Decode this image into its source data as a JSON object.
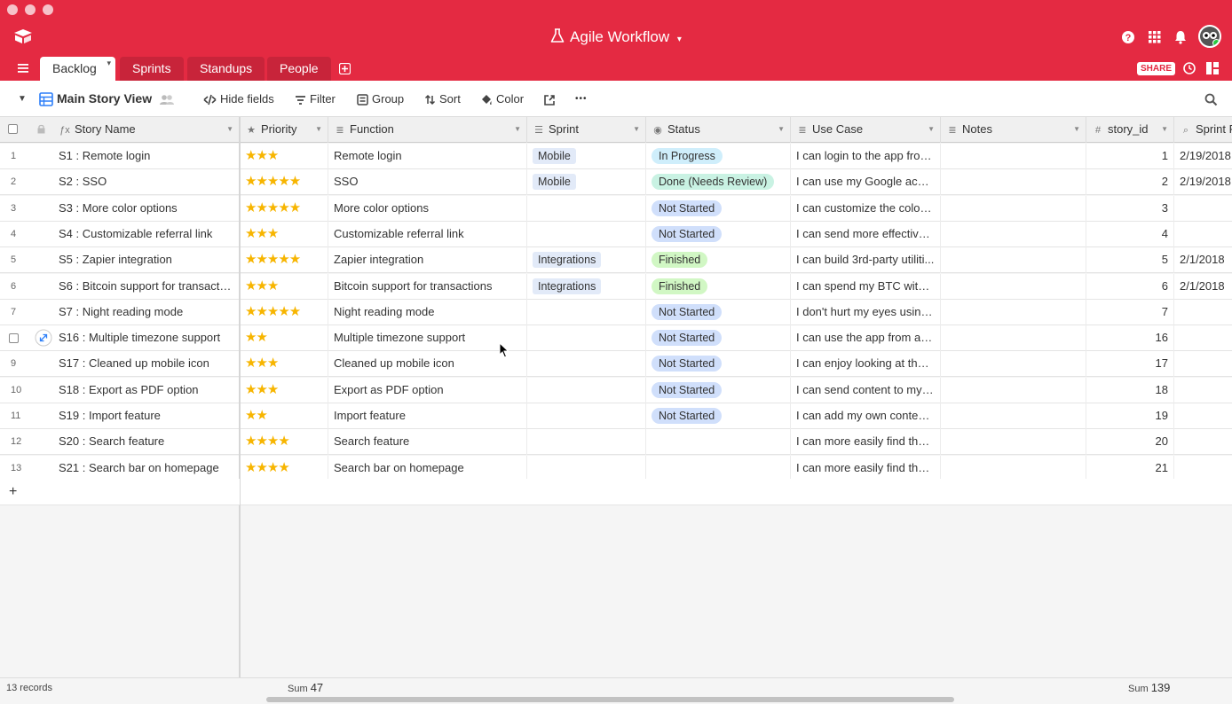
{
  "app": {
    "title": "Agile Workflow",
    "title_caret": "▾"
  },
  "tabs": [
    {
      "label": "Backlog",
      "caret": "▾"
    },
    {
      "label": "Sprints"
    },
    {
      "label": "Standups"
    },
    {
      "label": "People"
    }
  ],
  "header_actions": {
    "share_label": "SHARE"
  },
  "toolbar": {
    "view_name": "Main Story View",
    "hide_fields": "Hide fields",
    "filter": "Filter",
    "group": "Group",
    "sort": "Sort",
    "color": "Color",
    "more": "•••"
  },
  "columns": [
    {
      "label": "Story Name",
      "icon": "formula-icon",
      "glyph": "ƒx"
    },
    {
      "label": "Priority",
      "icon": "star-icon",
      "glyph": "★"
    },
    {
      "label": "Function",
      "icon": "long-text-icon",
      "glyph": "≣"
    },
    {
      "label": "Sprint",
      "icon": "link-icon",
      "glyph": "☰"
    },
    {
      "label": "Status",
      "icon": "single-select-icon",
      "glyph": "◉"
    },
    {
      "label": "Use Case",
      "icon": "long-text-icon",
      "glyph": "≣"
    },
    {
      "label": "Notes",
      "icon": "long-text-icon",
      "glyph": "≣"
    },
    {
      "label": "story_id",
      "icon": "number-icon",
      "glyph": "#"
    },
    {
      "label": "Sprint R",
      "icon": "lookup-icon",
      "glyph": "⌕"
    }
  ],
  "status_colors": {
    "In Progress": "#cfeefb",
    "Done (Needs Review)": "#c9f2e3",
    "Not Started": "#d0dffb",
    "Finished": "#d1f7c4"
  },
  "rows": [
    {
      "num": "1",
      "name": "S1 : Remote login",
      "priority": 3,
      "function": "Remote login",
      "sprint": "Mobile",
      "status": "In Progress",
      "use_case": "I can login to the app from...",
      "notes": "",
      "story_id": "1",
      "sprint_r": "2/19/2018"
    },
    {
      "num": "2",
      "name": "S2 : SSO",
      "priority": 5,
      "function": "SSO",
      "sprint": "Mobile",
      "status": "Done (Needs Review)",
      "use_case": "I can use my Google accou...",
      "notes": "",
      "story_id": "2",
      "sprint_r": "2/19/2018"
    },
    {
      "num": "3",
      "name": "S3 : More color options",
      "priority": 5,
      "function": "More color options",
      "sprint": "",
      "status": "Not Started",
      "use_case": "I can customize the colors...",
      "notes": "",
      "story_id": "3",
      "sprint_r": ""
    },
    {
      "num": "4",
      "name": "S4 : Customizable referral link",
      "priority": 3,
      "function": "Customizable referral link",
      "sprint": "",
      "status": "Not Started",
      "use_case": "I can send more effective r...",
      "notes": "",
      "story_id": "4",
      "sprint_r": ""
    },
    {
      "num": "5",
      "name": "S5 : Zapier integration",
      "priority": 5,
      "function": "Zapier integration",
      "sprint": "Integrations",
      "status": "Finished",
      "use_case": "I can build 3rd-party utiliti...",
      "notes": "",
      "story_id": "5",
      "sprint_r": "2/1/2018"
    },
    {
      "num": "6",
      "name": "S6 : Bitcoin support for transactio...",
      "priority": 3,
      "function": "Bitcoin support for transactions",
      "sprint": "Integrations",
      "status": "Finished",
      "use_case": "I can spend my BTC with y...",
      "notes": "",
      "story_id": "6",
      "sprint_r": "2/1/2018"
    },
    {
      "num": "7",
      "name": "S7 : Night reading mode",
      "priority": 5,
      "function": "Night reading mode",
      "sprint": "",
      "status": "Not Started",
      "use_case": "I don't hurt my eyes using ...",
      "notes": "",
      "story_id": "7",
      "sprint_r": ""
    },
    {
      "num": "",
      "name": "S16 : Multiple timezone support",
      "priority": 2,
      "function": "Multiple timezone support",
      "sprint": "",
      "status": "Not Started",
      "use_case": "I can use the app from aro...",
      "notes": "",
      "story_id": "16",
      "sprint_r": "",
      "hover": true
    },
    {
      "num": "9",
      "name": "S17 : Cleaned up mobile icon",
      "priority": 3,
      "function": "Cleaned up mobile icon",
      "sprint": "",
      "status": "Not Started",
      "use_case": "I can enjoy looking at the a...",
      "notes": "",
      "story_id": "17",
      "sprint_r": ""
    },
    {
      "num": "10",
      "name": "S18 : Export as PDF option",
      "priority": 3,
      "function": "Export as PDF option",
      "sprint": "",
      "status": "Not Started",
      "use_case": "I can send content to my b...",
      "notes": "",
      "story_id": "18",
      "sprint_r": ""
    },
    {
      "num": "11",
      "name": "S19 : Import feature",
      "priority": 2,
      "function": "Import feature",
      "sprint": "",
      "status": "Not Started",
      "use_case": "I can add my own content ...",
      "notes": "",
      "story_id": "19",
      "sprint_r": ""
    },
    {
      "num": "12",
      "name": "S20 : Search feature",
      "priority": 4,
      "function": "Search feature",
      "sprint": "",
      "status": "",
      "use_case": "I can more easily find the p...",
      "notes": "",
      "story_id": "20",
      "sprint_r": ""
    },
    {
      "num": "13",
      "name": "S21 : Search bar on homepage",
      "priority": 4,
      "function": "Search bar on homepage",
      "sprint": "",
      "status": "",
      "use_case": "I can more easily find the p...",
      "notes": "",
      "story_id": "21",
      "sprint_r": ""
    }
  ],
  "add_row": "+",
  "footer": {
    "records": "13 records",
    "sum_label_1": "Sum",
    "sum_value_1": "47",
    "sum_label_2": "Sum",
    "sum_value_2": "139"
  },
  "colors": {
    "brand": "#e42a42",
    "star": "#f7b500"
  }
}
